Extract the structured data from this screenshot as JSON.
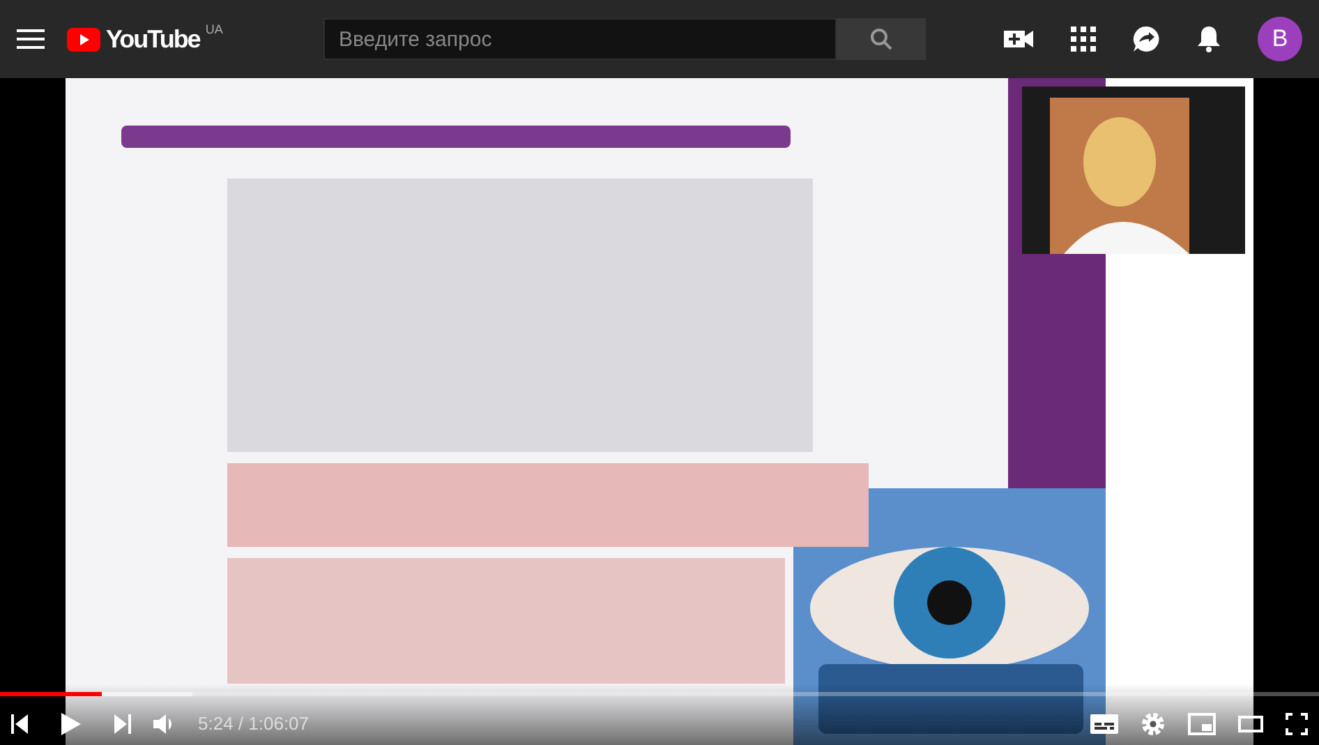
{
  "header": {
    "logo_text": "YouTube",
    "region": "UA",
    "search": {
      "placeholder": "Введите запрос"
    },
    "avatar_letter": "B"
  },
  "player": {
    "progress": {
      "level": 0.077
    },
    "buffer": {
      "level": 0.146
    },
    "time": "5:24 / 1:06:07",
    "playing": false
  }
}
